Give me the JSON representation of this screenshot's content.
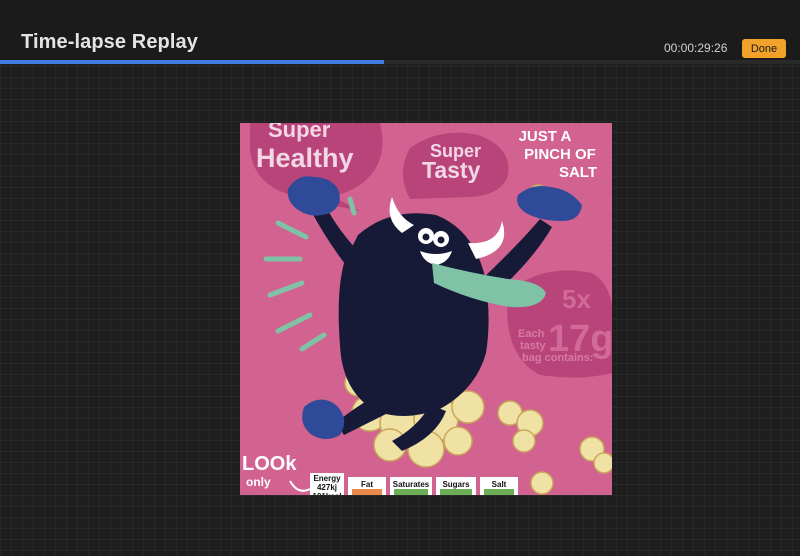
{
  "header": {
    "title": "Time-lapse Replay",
    "timestamp": "00:00:29:26",
    "done_label": "Done"
  },
  "playback": {
    "progress_fraction": 0.48
  },
  "artwork": {
    "bubble_left_line1": "Super",
    "bubble_left_line2": "Healthy",
    "bubble_mid_line1": "Super",
    "bubble_mid_line2": "Tasty",
    "salt_line1": "JUST A",
    "salt_line2": "PINCH OF",
    "salt_line3": "SALT",
    "pack_count": "5x",
    "pack_weight": "17g",
    "pack_note_line1": "Each",
    "pack_note_line2": "tasty",
    "pack_note_line3": "bag contains:",
    "look_only_line1": "LOOk",
    "look_only_line2": "only",
    "nutrition": {
      "energy_label": "Energy",
      "energy_kj": "427kj",
      "energy_kcal": "101kcal",
      "fat": "Fat",
      "saturates": "Saturates",
      "sugars": "Sugars",
      "salt": "Salt"
    },
    "colors": {
      "background": "#d2628f",
      "bubble": "#b8447a",
      "monster": "#161a36",
      "tongue": "#7fc2a6",
      "hands": "#2f4a99",
      "popcorn": "#f0e2a4"
    }
  }
}
